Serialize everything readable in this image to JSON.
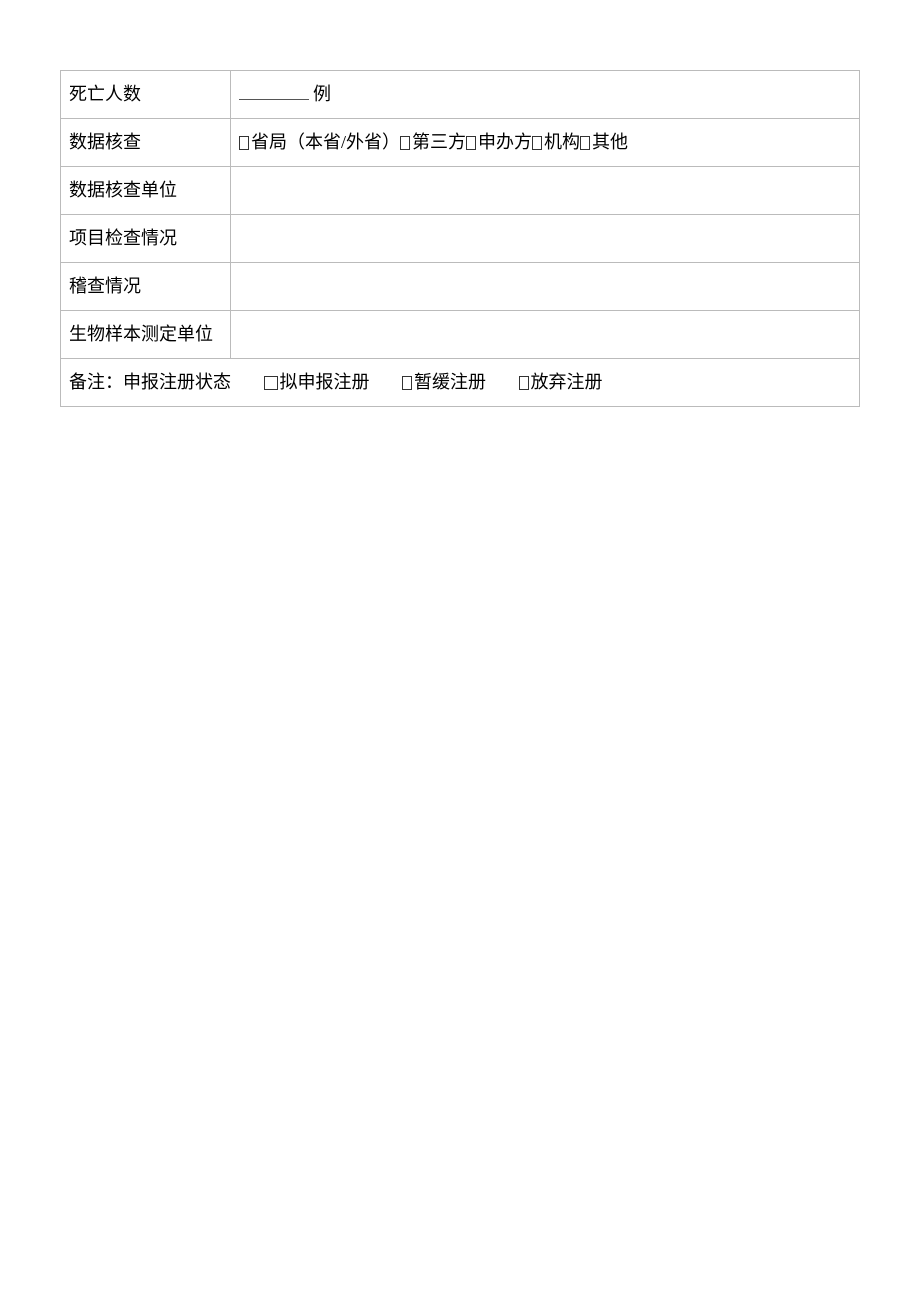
{
  "rows": {
    "death_count": {
      "label": "死亡人数",
      "unit": "例",
      "value": ""
    },
    "data_check": {
      "label": "数据核查",
      "options": [
        {
          "text": "省局（本省/外省）"
        },
        {
          "text": "第三方"
        },
        {
          "text": "申办方"
        },
        {
          "text": "机构"
        },
        {
          "text": "其他"
        }
      ]
    },
    "data_check_unit": {
      "label": "数据核查单位",
      "value": ""
    },
    "project_inspection": {
      "label": "项目检查情况",
      "value": ""
    },
    "audit": {
      "label": "稽查情况",
      "value": ""
    },
    "biosample_unit": {
      "label": "生物样本测定单位",
      "value": ""
    }
  },
  "remark": {
    "label": "备注：申报注册状态",
    "options": [
      {
        "text": "拟申报注册"
      },
      {
        "text": "暂缓注册"
      },
      {
        "text": "放弃注册"
      }
    ]
  }
}
